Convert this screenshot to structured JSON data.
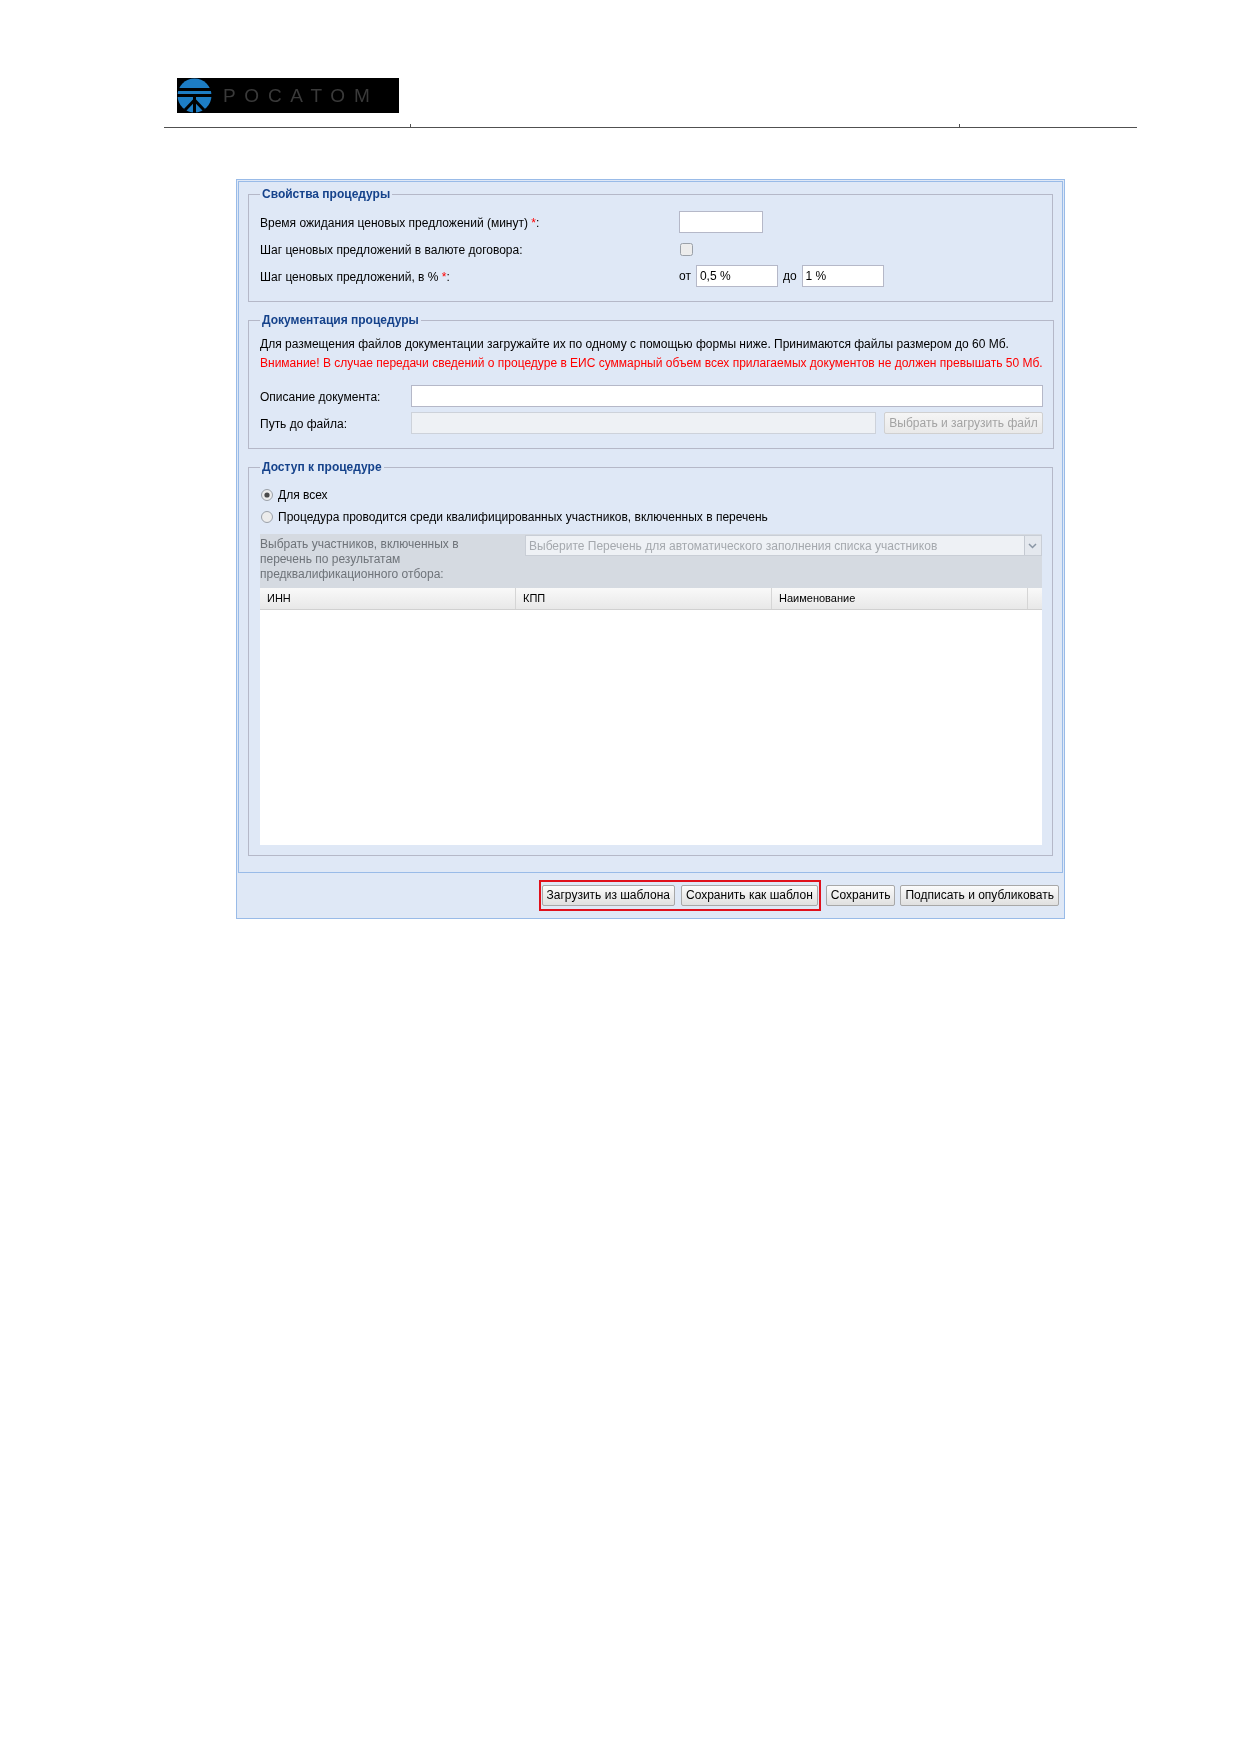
{
  "header": {
    "logo_text": "РОСАТОМ"
  },
  "properties": {
    "legend": "Свойства процедуры",
    "rows": [
      {
        "kind": "text_input",
        "label": "Время ожидания ценовых предложений (минут)",
        "required_mark": "*",
        "label_end": ":"
      },
      {
        "kind": "checkbox",
        "label": "Шаг ценовых предложений в валюте договора:",
        "checked": false
      },
      {
        "kind": "range",
        "label": "Шаг ценовых предложений, в %",
        "required_mark": "*",
        "label_end": ":",
        "from_label": "от",
        "from_value": "0,5 %",
        "to_label": "до",
        "to_value": "1 %"
      }
    ]
  },
  "documentation": {
    "legend": "Документация процедуры",
    "info_text": "Для размещения файлов документации загружайте их по одному с помощью формы ниже. Принимаются файлы размером до 60 Мб.",
    "warning_text": "Внимание! В случае передачи сведений о процедуре в ЕИС суммарный объем всех прилагаемых документов не должен превышать 50 Мб.",
    "description_field": {
      "label": "Описание документа:"
    },
    "file_field": {
      "label": "Путь до файла:",
      "disabled": true
    },
    "upload_button": {
      "label": "Выбрать и загрузить файл",
      "disabled": true
    }
  },
  "access": {
    "legend": "Доступ к процедуре",
    "options": [
      {
        "label": "Для всех",
        "selected": true
      },
      {
        "label": "Процедура проводится среди квалифицированных участников, включенных в перечень",
        "selected": false
      }
    ],
    "participants_select": {
      "label": "Выбрать участников, включенных в перечень по результатам предквалификационного отбора:",
      "placeholder": "Выберите Перечень для автоматического заполнения списка участников",
      "disabled": true
    },
    "table": {
      "columns": [
        "ИНН",
        "КПП",
        "Наименование"
      ]
    }
  },
  "footer": {
    "highlight_group": [
      "Загрузить из шаблона",
      "Сохранить как шаблон"
    ],
    "buttons": [
      "Сохранить",
      "Подписать и опубликовать"
    ]
  }
}
